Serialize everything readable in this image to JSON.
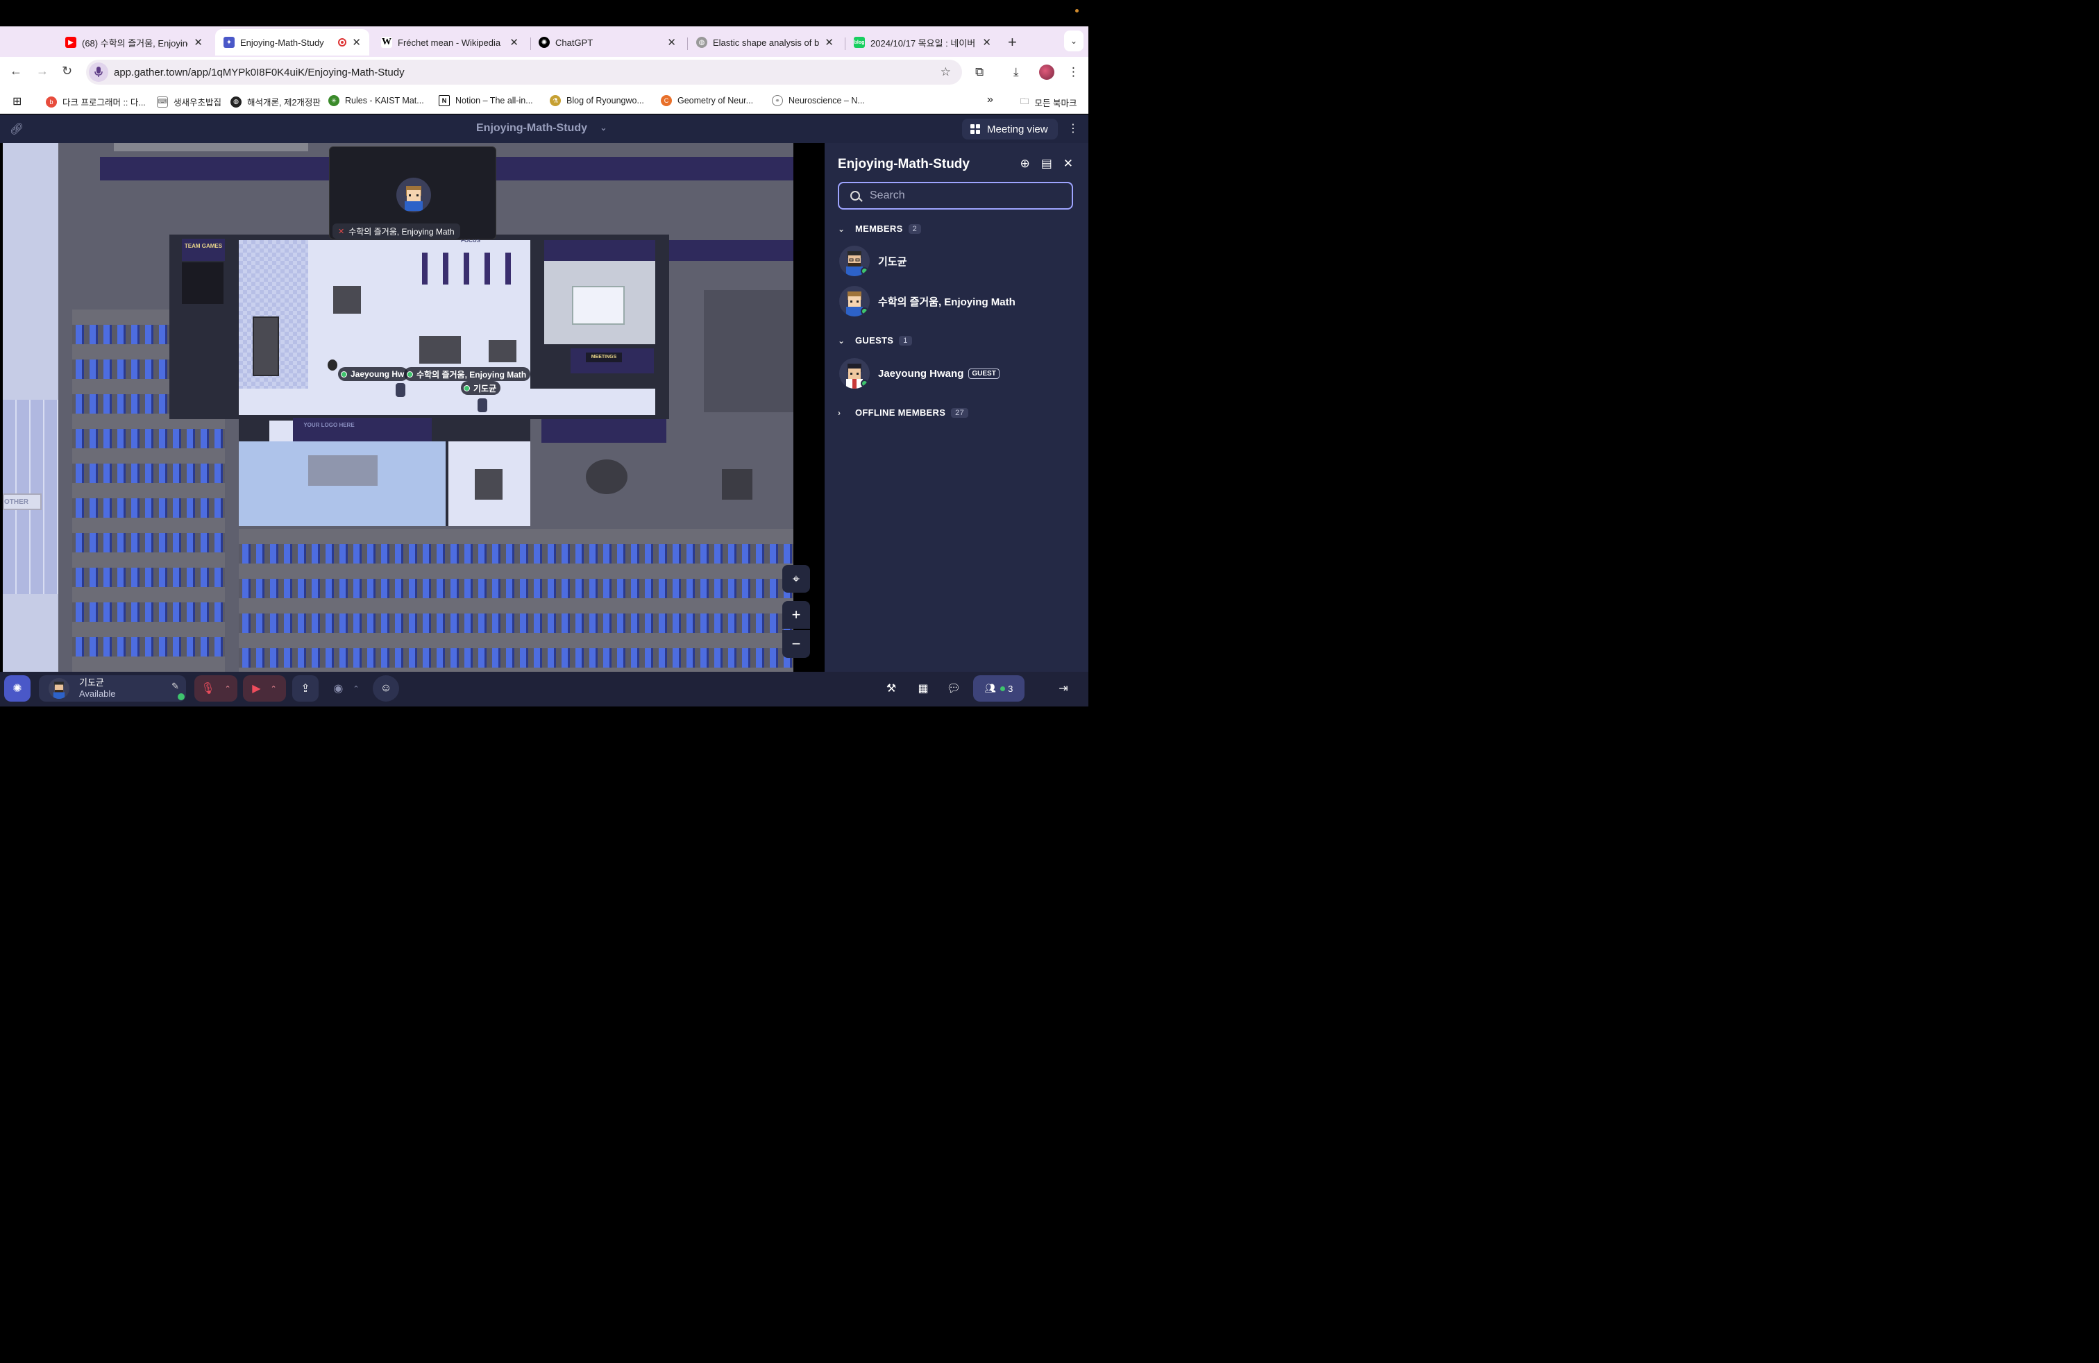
{
  "browser": {
    "tabs": [
      {
        "title": "(68) 수학의 즐거움, Enjoying",
        "favicon": "youtube-icon",
        "color": "#ff0000",
        "active": false
      },
      {
        "title": "Enjoying-Math-Study",
        "favicon": "gather-icon",
        "color": "#4a58c8",
        "active": true
      },
      {
        "title": "Fréchet mean - Wikipedia",
        "favicon": "wikipedia-icon",
        "color": "#ffffff",
        "active": false
      },
      {
        "title": "ChatGPT",
        "favicon": "chatgpt-icon",
        "color": "#000000",
        "active": false
      },
      {
        "title": "Elastic shape analysis of b",
        "favicon": "globe-icon",
        "color": "#888888",
        "active": false
      },
      {
        "title": "2024/10/17 목요일 : 네이버",
        "favicon": "naver-blog-icon",
        "color": "#19ce60",
        "active": false
      }
    ],
    "new_tab": "+",
    "url": "app.gather.town/app/1qMYPk0I8F0K4uiK/Enjoying-Math-Study",
    "bookmarks": [
      {
        "label": "다크 프로그래머 :: 다...",
        "icon": "blog-icon",
        "color": "#e74c3c"
      },
      {
        "label": "생새우초밥집",
        "icon": "keyboard-icon",
        "color": "#666666"
      },
      {
        "label": "해석개론, 제2개정판",
        "icon": "globe-icon",
        "color": "#222222"
      },
      {
        "label": "Rules - KAIST Mat...",
        "icon": "kaist-icon",
        "color": "#3a8a2a"
      },
      {
        "label": "Notion – The all-in...",
        "icon": "notion-icon",
        "color": "#000000"
      },
      {
        "label": "Blog of Ryoungwo...",
        "icon": "jekyll-icon",
        "color": "#c6a032"
      },
      {
        "label": "Geometry of Neur...",
        "icon": "orange-c-icon",
        "color": "#e8702a"
      },
      {
        "label": "Neuroscience – N...",
        "icon": "chain-icon",
        "color": "#777777"
      }
    ],
    "bookmarks_overflow": "»",
    "all_bookmarks": "모든 북마크"
  },
  "gather": {
    "space_title": "Enjoying-Math-Study",
    "meeting_view": "Meeting view",
    "video_tile_name": "수학의 즐거움, Enjoying Math",
    "nametags": [
      {
        "label": "Jaeyoung Hw"
      },
      {
        "label": "수학의 즐거움, Enjoying Math"
      },
      {
        "label": "기도균"
      }
    ],
    "map_signs": {
      "team_games": "TEAM GAMES",
      "focus": "FOCUS",
      "meetings": "MEETINGS",
      "your_logo": "YOUR LOGO HERE",
      "other": "OTHER"
    }
  },
  "sidebar": {
    "title": "Enjoying-Math-Study",
    "search_placeholder": "Search",
    "members_label": "MEMBERS",
    "members_count": "2",
    "members": [
      {
        "name": "기도균"
      },
      {
        "name": "수학의 즐거움, Enjoying Math"
      }
    ],
    "guests_label": "GUESTS",
    "guests_count": "1",
    "guests": [
      {
        "name": "Jaeyoung Hwang",
        "badge": "GUEST"
      }
    ],
    "offline_label": "OFFLINE MEMBERS",
    "offline_count": "27"
  },
  "bottombar": {
    "user_name": "기도균",
    "user_status": "Available",
    "participants_count": "3"
  }
}
